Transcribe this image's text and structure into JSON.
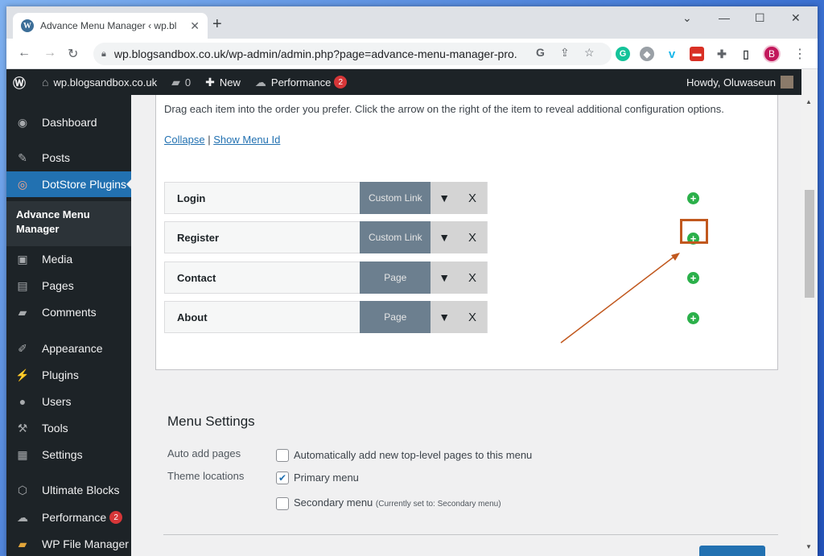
{
  "browser": {
    "tab_title": "Advance Menu Manager ‹ wp.bl",
    "tab_close": "✕",
    "new_tab": "+",
    "url": "wp.blogsandbox.co.uk/wp-admin/admin.php?page=advance-menu-manager-pro...",
    "profile_initial": "B",
    "window_controls": [
      "⌄",
      "—",
      "☐",
      "✕"
    ]
  },
  "adminbar": {
    "site_name": "wp.blogsandbox.co.uk",
    "comments_count": "0",
    "new_label": "New",
    "performance_label": "Performance",
    "performance_badge": "2",
    "howdy": "Howdy, Oluwaseun"
  },
  "sidebar": {
    "items": [
      {
        "label": "Dashboard",
        "icon": "dashboard-icon"
      },
      {
        "label": "Posts",
        "icon": "pin-icon"
      },
      {
        "label": "DotStore Plugins",
        "icon": "target-icon"
      },
      {
        "label": "Media",
        "icon": "media-icon"
      },
      {
        "label": "Pages",
        "icon": "pages-icon"
      },
      {
        "label": "Comments",
        "icon": "comment-icon"
      },
      {
        "label": "Appearance",
        "icon": "brush-icon"
      },
      {
        "label": "Plugins",
        "icon": "plugin-icon"
      },
      {
        "label": "Users",
        "icon": "user-icon"
      },
      {
        "label": "Tools",
        "icon": "wrench-icon"
      },
      {
        "label": "Settings",
        "icon": "settings-icon"
      },
      {
        "label": "Ultimate Blocks",
        "icon": "blocks-icon"
      },
      {
        "label": "Performance",
        "icon": "gauge-icon",
        "badge": "2"
      },
      {
        "label": "WP File Manager",
        "icon": "folder-icon"
      }
    ],
    "submenu": "Advance Menu Manager"
  },
  "main": {
    "instructions": "Drag each item into the order you prefer. Click the arrow on the right of the item to reveal additional configuration options.",
    "collapse_link": "Collapse",
    "separator": "|",
    "show_menu_id_link": "Show Menu Id",
    "menu_items": [
      {
        "name": "Login",
        "type": "Custom Link"
      },
      {
        "name": "Register",
        "type": "Custom Link"
      },
      {
        "name": "Contact",
        "type": "Page"
      },
      {
        "name": "About",
        "type": "Page"
      }
    ],
    "remove_label": "X"
  },
  "settings": {
    "title": "Menu Settings",
    "auto_add_label": "Auto add pages",
    "auto_add_text": "Automatically add new top-level pages to this menu",
    "auto_add_checked": false,
    "theme_locations_label": "Theme locations",
    "primary_text": "Primary menu",
    "primary_checked": true,
    "secondary_text": "Secondary menu",
    "secondary_note": "(Currently set to: Secondary menu)",
    "secondary_checked": false
  },
  "colors": {
    "wp_dark": "#1d2327",
    "wp_blue": "#2271b1",
    "add_green": "#2bb04a",
    "annotation": "#c1581e"
  }
}
